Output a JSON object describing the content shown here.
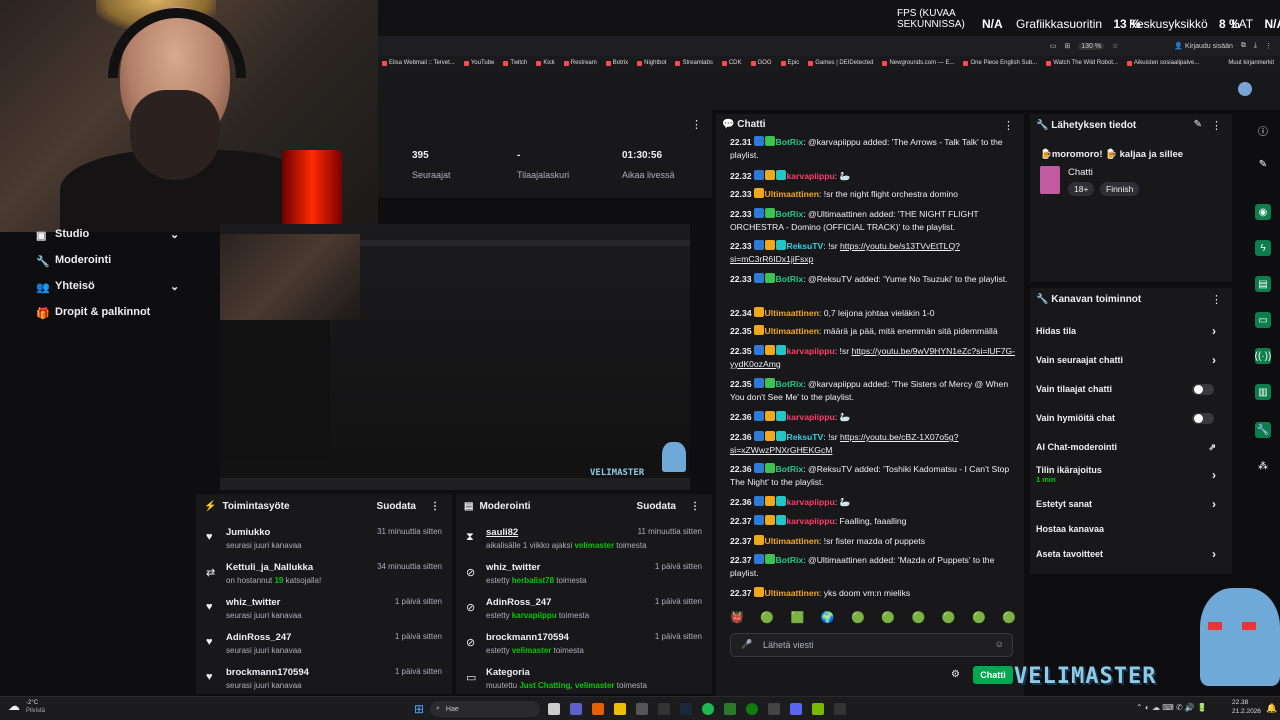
{
  "perf": {
    "fps_label": "FPS (KUVAA SEKUNNISSA)",
    "fps_value": "N/A",
    "gpu_label": "Grafiikkasuoritin",
    "gpu_value": "13 %",
    "cpu_label": "Keskusyksikkö",
    "cpu_value": "8 %",
    "lat_label": "LAT",
    "lat_value": "N/A"
  },
  "browser": {
    "zoom": "130 %",
    "signin": "Kirjaudu sisään",
    "bookmarks": [
      "Elisa Webmail :: Tervet...",
      "YouTube",
      "Twitch",
      "Kick",
      "Restream",
      "Botrix",
      "Nightbot",
      "Streamlabs",
      "CDK",
      "GOG",
      "Epic",
      "Games | DEIDetected",
      "Newgrounds.com — E...",
      "One Piece English Sub...",
      "Watch The Wild Robot...",
      "Aikuisten sosiaalipalve..."
    ],
    "bookmarks_more": "Muut kirjanmerkit"
  },
  "sidebar": {
    "items": [
      {
        "label": "Studio"
      },
      {
        "label": "Moderointi"
      },
      {
        "label": "Yhteisö"
      },
      {
        "label": "Dropit & palkinnot"
      }
    ]
  },
  "stats": {
    "followers_value": "395",
    "followers_label": "Seuraajat",
    "subs_value": "-",
    "subs_label": "Tilaajalaskuri",
    "live_value": "01:30:56",
    "live_label": "Aikaa livessä"
  },
  "video": {
    "overlay": "VELIMASTER"
  },
  "activity": {
    "title": "Toimintasyöte",
    "filter": "Suodata",
    "items": [
      {
        "name": "Jumiukko",
        "sub": "seurasi juuri kanavaa",
        "time": "31 minuuttia sitten"
      },
      {
        "name": "Kettuli_ja_Nallukka",
        "sub_pre": "on hostannut ",
        "sub_num": "19",
        "sub_post": " katsojalla!",
        "time": "34 minuuttia sitten"
      },
      {
        "name": "whiz_twitter",
        "sub": "seurasi juuri kanavaa",
        "time": "1 päivä sitten"
      },
      {
        "name": "AdinRoss_247",
        "sub": "seurasi juuri kanavaa",
        "time": "1 päivä sitten"
      },
      {
        "name": "brockmann170594",
        "sub": "seurasi juuri kanavaa",
        "time": "1 päivä sitten"
      }
    ]
  },
  "moderation": {
    "title": "Moderointi",
    "filter": "Suodata",
    "items": [
      {
        "name": "sauli82",
        "sub_pre": "aikalisälle 1 viikko ajaksi ",
        "mod": "velimaster",
        "sub_post": " toimesta",
        "time": "11 minuuttia sitten"
      },
      {
        "name": "whiz_twitter",
        "sub_pre": "estetty ",
        "mod": "herbalist78",
        "sub_post": " toimesta",
        "time": "1 päivä sitten"
      },
      {
        "name": "AdinRoss_247",
        "sub_pre": "estetty ",
        "mod": "karvapiippu",
        "sub_post": " toimesta",
        "time": "1 päivä sitten"
      },
      {
        "name": "brockmann170594",
        "sub_pre": "estetty ",
        "mod": "velimaster",
        "sub_post": " toimesta",
        "time": "1 päivä sitten"
      },
      {
        "name": "Kategoria",
        "sub_pre": "muutettu ",
        "mod": "Just Chatting",
        "mod2": "velimaster",
        "sub_post": " toimesta",
        "time": ""
      }
    ]
  },
  "chat": {
    "title": "Chatti",
    "messages": [
      {
        "t": "22.31",
        "badges": [
          "blue",
          "green"
        ],
        "user": "BotRix",
        "ucls": "u-bot",
        "text": ": @karvapiippu added: 'The Arrows - Talk Talk' to the playlist."
      },
      {
        "t": "22.32",
        "badges": [
          "blue",
          "gold",
          "cyan"
        ],
        "user": "karvapiippu",
        "ucls": "u-karv",
        "text": ": 🦢"
      },
      {
        "t": "22.33",
        "badges": [
          "gold"
        ],
        "user": "Ultimaattinen",
        "ucls": "u-ult",
        "text": ": !sr the night flight orchestra domino"
      },
      {
        "t": "22.33",
        "badges": [
          "blue",
          "green"
        ],
        "user": "BotRix",
        "ucls": "u-bot",
        "text": ": @Ultimaattinen added: 'THE NIGHT FLIGHT ORCHESTRA - Domino (OFFICIAL TRACK)' to the playlist."
      },
      {
        "t": "22.33",
        "badges": [
          "blue",
          "gold",
          "cyan"
        ],
        "user": "ReksuTV",
        "ucls": "u-rek",
        "text": ": !sr ",
        "link": "https://youtu.be/s13TVvEtTLQ?si=mC3rR6IDx1jiFsxp"
      },
      {
        "t": "22.33",
        "badges": [
          "blue",
          "green"
        ],
        "user": "BotRix",
        "ucls": "u-bot",
        "text": ": @ReksuTV added: 'Yume No Tsuzuki' to the playlist."
      },
      {
        "t": "22.34",
        "badges": [
          "gold"
        ],
        "user": "Ultimaattinen",
        "ucls": "u-ult",
        "text": ": 0,7 leijona johtaa vieläkin 1-0"
      },
      {
        "t": "22.35",
        "badges": [
          "gold"
        ],
        "user": "Ultimaattinen",
        "ucls": "u-ult",
        "text": ": määrä ja pää, mitä enemmän sitä pidemmällä"
      },
      {
        "t": "22.35",
        "badges": [
          "blue",
          "gold",
          "cyan"
        ],
        "user": "karvapiippu",
        "ucls": "u-karv",
        "text": ": !sr ",
        "link": "https://youtu.be/9wV9HYN1eZc?si=lUF7G-yydK0ozAmg"
      },
      {
        "t": "22.35",
        "badges": [
          "blue",
          "green"
        ],
        "user": "BotRix",
        "ucls": "u-bot",
        "text": ": @karvapiippu added: 'The Sisters of Mercy @ When You don't See Me' to the playlist."
      },
      {
        "t": "22.36",
        "badges": [
          "blue",
          "gold",
          "cyan"
        ],
        "user": "karvapiippu",
        "ucls": "u-karv",
        "text": ": 🦢"
      },
      {
        "t": "22.36",
        "badges": [
          "blue",
          "gold",
          "cyan"
        ],
        "user": "ReksuTV",
        "ucls": "u-rek",
        "text": ": !sr ",
        "link": "https://youtu.be/cBZ-1X07o5g?si=xZWwzPNXrGHEKGcM"
      },
      {
        "t": "22.36",
        "badges": [
          "blue",
          "green"
        ],
        "user": "BotRix",
        "ucls": "u-bot",
        "text": ": @ReksuTV added: 'Toshiki Kadomatsu - I Can't Stop The Night' to the playlist."
      },
      {
        "t": "22.36",
        "badges": [
          "blue",
          "gold",
          "cyan"
        ],
        "user": "karvapiippu",
        "ucls": "u-karv",
        "text": ": 🦢"
      },
      {
        "t": "22.37",
        "badges": [
          "blue",
          "gold",
          "cyan"
        ],
        "user": "karvapiippu",
        "ucls": "u-karv",
        "text": ": Faalling, faaalling"
      },
      {
        "t": "22.37",
        "badges": [
          "gold"
        ],
        "user": "Ultimaattinen",
        "ucls": "u-ult",
        "text": ": !sr fister mazda of puppets"
      },
      {
        "t": "22.37",
        "badges": [
          "blue",
          "green"
        ],
        "user": "BotRix",
        "ucls": "u-bot",
        "text": ": @Ultimaattinen added: 'Mazda of Puppets' to the playlist."
      },
      {
        "t": "22.37",
        "badges": [
          "gold"
        ],
        "user": "Ultimaattinen",
        "ucls": "u-ult",
        "text": ": yks doom vm:n mieliks"
      }
    ],
    "input_placeholder": "Lähetä viesti",
    "send_label": "Chatti"
  },
  "stream_info": {
    "title": "Lähetyksen tiedot",
    "stream_title_pre": "moromoro! ",
    "stream_title_post": " kaljaa ja sillee",
    "category": "Chatti",
    "tags": [
      "18+",
      "Finnish"
    ]
  },
  "channel_actions": {
    "title": "Kanavan toiminnot",
    "items": [
      {
        "label": "Hidas tila",
        "kind": "chevron"
      },
      {
        "label": "Vain seuraajat chatti",
        "kind": "chevron"
      },
      {
        "label": "Vain tilaajat chatti",
        "kind": "toggle"
      },
      {
        "label": "Vain hymiöitä chat",
        "kind": "toggle"
      },
      {
        "label": "AI Chat-moderointi",
        "kind": "external"
      },
      {
        "label": "Tilin ikärajoitus",
        "sub": "1 min",
        "kind": "chevron"
      },
      {
        "label": "Estetyt sanat",
        "kind": "chevron"
      },
      {
        "label": "Hostaa kanavaa",
        "kind": "none"
      },
      {
        "label": "Aseta tavoitteet",
        "kind": "chevron"
      }
    ]
  },
  "overlay_brand": "VELIMASTER",
  "taskbar": {
    "weather_temp": "-2°C",
    "weather_desc": "Pilvistä",
    "search": "Hae",
    "time": "22.38",
    "date": "21.2.2026"
  },
  "colors": {
    "accent_green": "#00a84f",
    "bg": "#0e0e10",
    "panel": "#18181b"
  }
}
